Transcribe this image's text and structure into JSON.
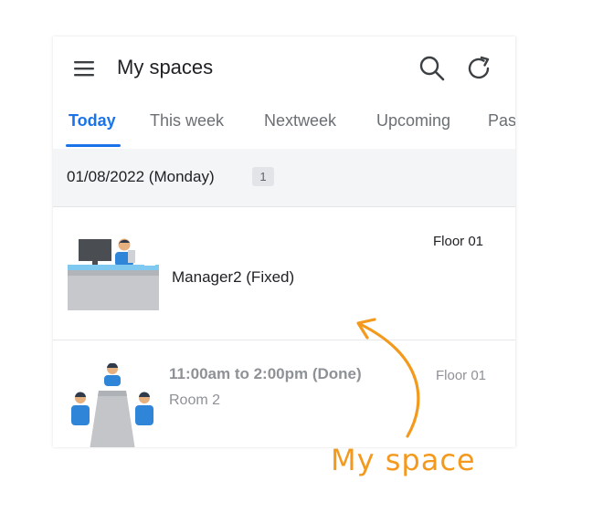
{
  "header": {
    "title": "My spaces"
  },
  "tabs": [
    {
      "label": "Today",
      "active": true
    },
    {
      "label": "This week",
      "active": false
    },
    {
      "label": "Nextweek",
      "active": false
    },
    {
      "label": "Upcoming",
      "active": false
    },
    {
      "label": "Pas",
      "active": false
    }
  ],
  "date_group": {
    "label": "01/08/2022 (Monday)",
    "count": "1"
  },
  "bookings": [
    {
      "icon": "desk-workstation-icon",
      "title": "Manager2 (Fixed)",
      "floor": "Floor 01"
    },
    {
      "icon": "meeting-room-icon",
      "title": "11:00am to 2:00pm (Done)",
      "subtitle": "Room 2",
      "floor": "Floor 01"
    }
  ],
  "annotation": {
    "text": "My space"
  },
  "colors": {
    "accent": "#1a73e8",
    "annotation": "#f39a1e",
    "group_background": "#f4f5f7"
  }
}
